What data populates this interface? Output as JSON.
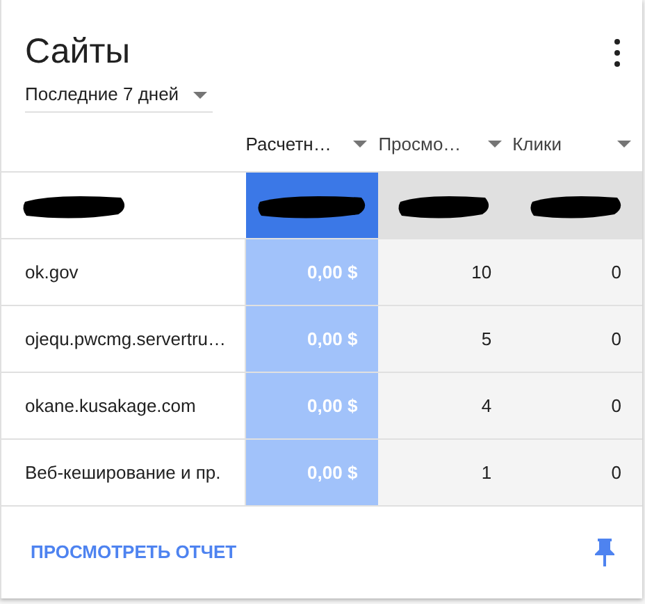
{
  "card": {
    "title": "Сайты",
    "period": "Последние 7 дней"
  },
  "table": {
    "columns": [
      {
        "label": "Расчетн…",
        "selected": true
      },
      {
        "label": "Просмо…",
        "selected": false
      },
      {
        "label": "Клики",
        "selected": false
      }
    ],
    "rows": [
      {
        "site": "ok.gov",
        "cells": [
          "0,00 $",
          "10",
          "0"
        ]
      },
      {
        "site": "ojequ.pwcmg.servertru…",
        "cells": [
          "0,00 $",
          "5",
          "0"
        ]
      },
      {
        "site": "okane.kusakage.com",
        "cells": [
          "0,00 $",
          "4",
          "0"
        ]
      },
      {
        "site": "Веб-кеширование и пр.",
        "cells": [
          "0,00 $",
          "1",
          "0"
        ]
      }
    ]
  },
  "footer": {
    "link": "ПРОСМОТРЕТЬ ОТЧЕТ"
  }
}
